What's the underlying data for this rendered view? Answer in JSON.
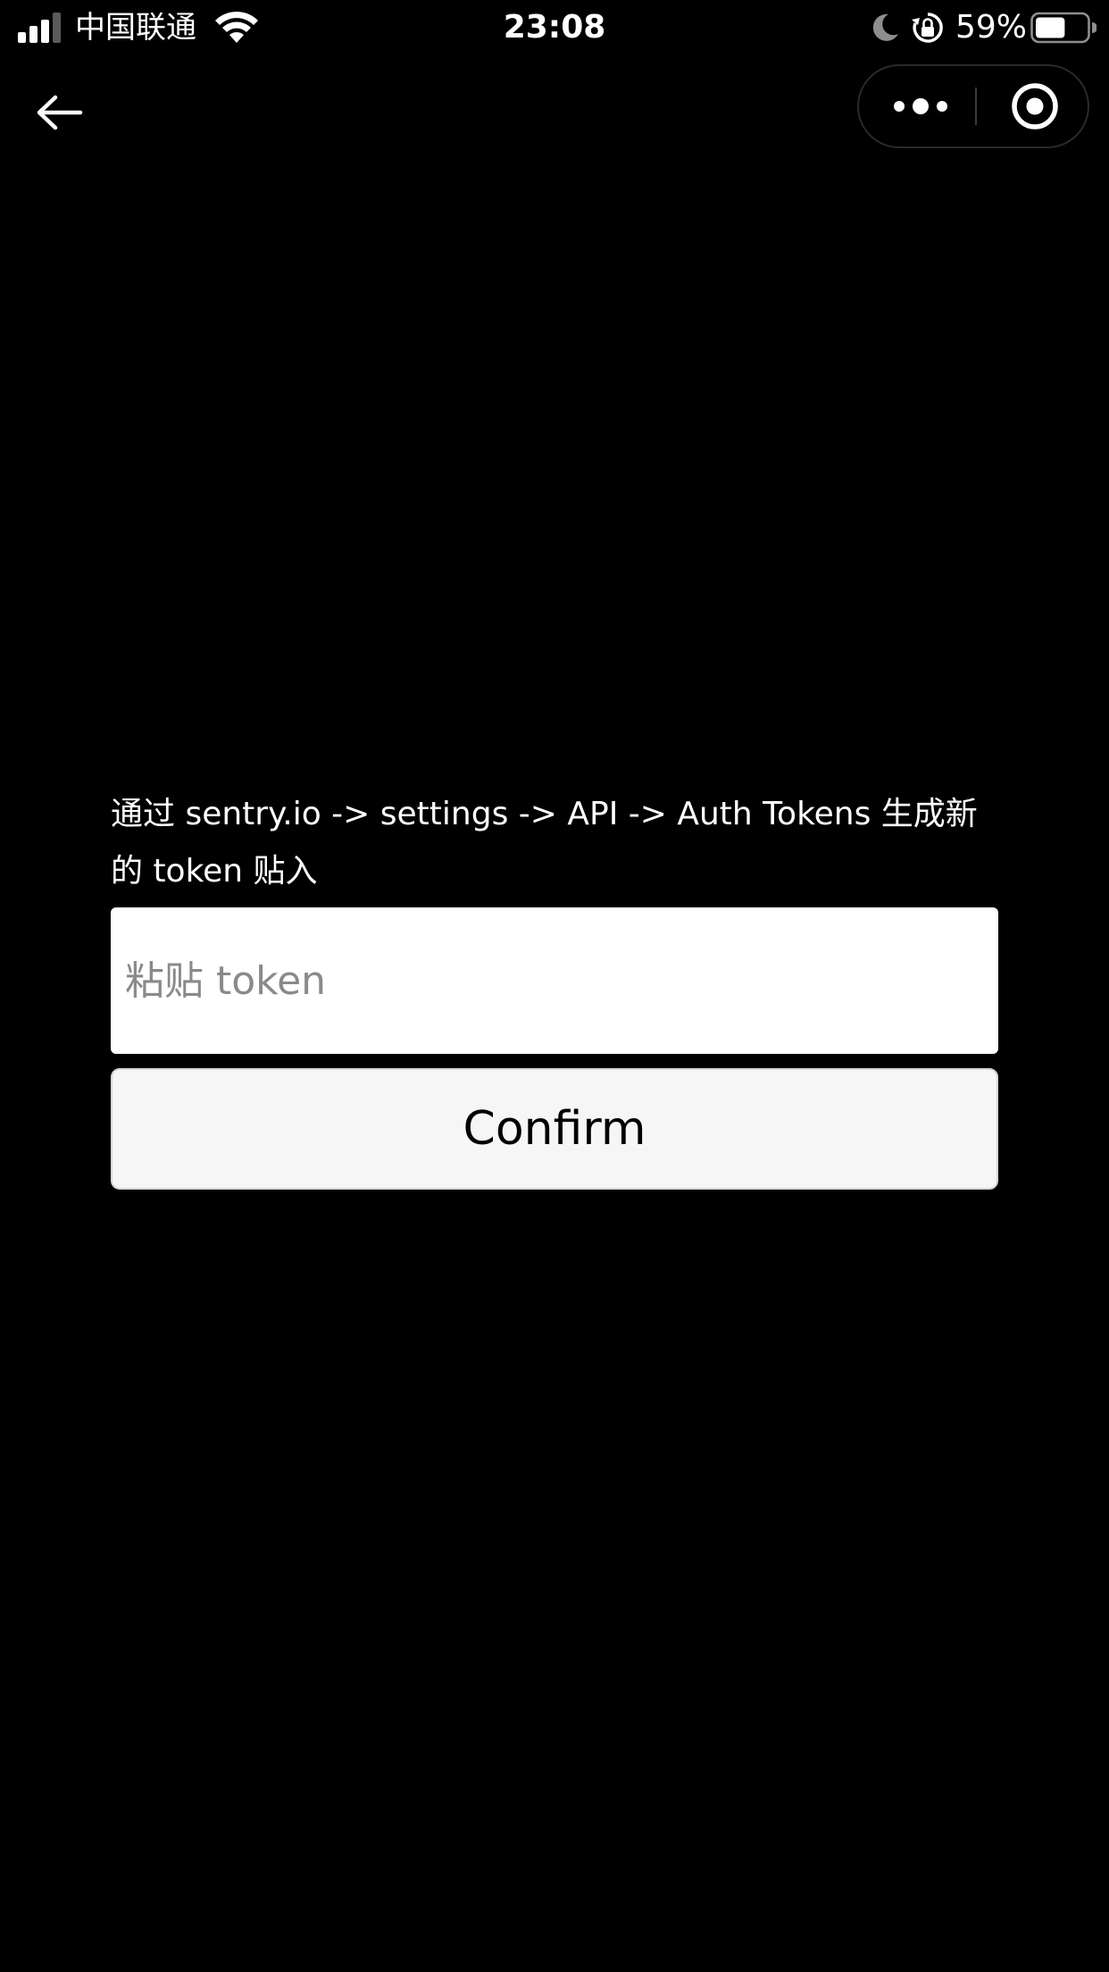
{
  "status_bar": {
    "carrier": "中国联通",
    "time": "23:08",
    "battery_percent": "59%",
    "battery_level": 0.59,
    "signal_bars_active": 3,
    "icons": [
      "signal-icon",
      "wifi-icon",
      "moon-icon",
      "rotation-lock-icon",
      "battery-icon"
    ]
  },
  "nav": {
    "back_icon": "arrow-left-icon",
    "capsule": {
      "more_icon": "more-dots-icon",
      "close_icon": "target-circle-icon"
    }
  },
  "content": {
    "instruction": "通过 sentry.io -> settings -> API -> Auth Tokens 生成新的 token 贴入",
    "token_input": {
      "placeholder": "粘贴 token",
      "value": ""
    },
    "confirm_label": "Confirm"
  },
  "colors": {
    "background": "#000000",
    "text": "#ffffff",
    "input_background": "#ffffff",
    "placeholder": "#8a8a8a",
    "button_background": "#f6f6f6",
    "button_border": "#d6d6d6"
  }
}
